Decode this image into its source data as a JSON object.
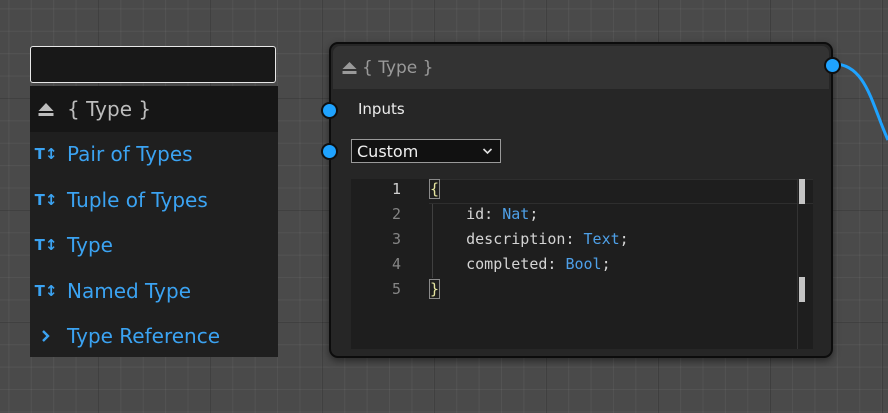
{
  "palette": {
    "search_value": "",
    "items": [
      {
        "label": "{ Type }",
        "icon": "eject-icon"
      },
      {
        "label": "Pair of Types",
        "icon": "type-text-icon"
      },
      {
        "label": "Tuple of Types",
        "icon": "type-text-icon"
      },
      {
        "label": "Type",
        "icon": "type-text-icon"
      },
      {
        "label": "Named Type",
        "icon": "type-text-icon"
      },
      {
        "label": "Type Reference",
        "icon": "chevron-right-icon"
      }
    ]
  },
  "node": {
    "title": "{ Type }",
    "inputs_label": "Inputs",
    "type_select": {
      "value": "Custom",
      "options": [
        "Custom"
      ]
    },
    "code": {
      "line_numbers": [
        "1",
        "2",
        "3",
        "4",
        "5"
      ],
      "active_line": 1,
      "lines": [
        "{",
        "    id: Nat;",
        "    description: Text;",
        "    completed: Bool;",
        "}"
      ]
    }
  },
  "colors": {
    "accent": "#3ba3f2",
    "port": "#1fa3ff",
    "canvas": "#4a4a4a",
    "node_bg": "#262626",
    "editor_bg": "#1e1e1e"
  }
}
